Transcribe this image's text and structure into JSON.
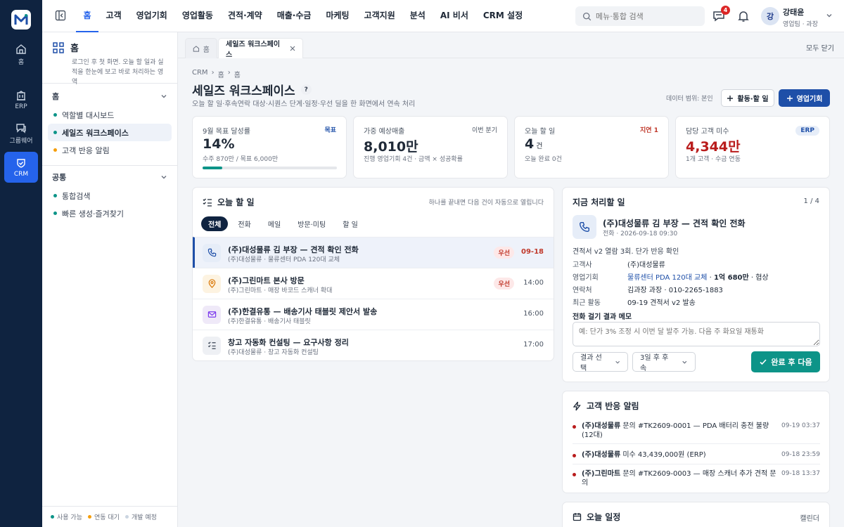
{
  "colors": {
    "primary": "#1e4fa8",
    "accent": "#2563eb",
    "teal": "#0d9488",
    "danger": "#b91c1c",
    "rail": "#0f2340"
  },
  "rail": {
    "items": [
      {
        "label": "홈",
        "icon": "home-icon"
      },
      {
        "label": "ERP",
        "icon": "building-icon"
      },
      {
        "label": "그룹웨어",
        "icon": "chat-icon"
      },
      {
        "label": "CRM",
        "icon": "handshake-icon"
      }
    ]
  },
  "topnav": {
    "items": [
      "홈",
      "고객",
      "영업기회",
      "영업활동",
      "견적·계약",
      "매출·수금",
      "마케팅",
      "고객지원",
      "분석",
      "AI 비서",
      "CRM 설정"
    ],
    "active": "홈",
    "search_placeholder": "메뉴·통합 검색",
    "notif_count": "4",
    "user_initial": "강",
    "user_name": "강태윤",
    "user_role": "영업팀 · 과장"
  },
  "sidebar": {
    "title": "홈",
    "desc": "로그인 후 첫 화면. 오늘 할 일과 실적을 한눈에 보고 바로 처리하는 영역",
    "groups": [
      {
        "title": "홈",
        "items": [
          {
            "label": "역할별 대시보드",
            "status": "available"
          },
          {
            "label": "세일즈 워크스페이스",
            "status": "available"
          },
          {
            "label": "고객 반응 알림",
            "status": "pending"
          }
        ]
      },
      {
        "title": "공통",
        "items": [
          {
            "label": "통합검색",
            "status": "available"
          },
          {
            "label": "빠른 생성·즐겨찾기",
            "status": "available"
          }
        ]
      }
    ],
    "legend": [
      "사용 가능",
      "연동 대기",
      "개발 예정"
    ]
  },
  "tabs": {
    "home": "홈",
    "current": "세일즈 워크스페이스",
    "close_all": "모두 닫기"
  },
  "page": {
    "breadcrumb": [
      "CRM",
      "홈",
      "홈"
    ],
    "title": "세일즈 워크스페이스",
    "help": "?",
    "subtitle": "오늘 할 일·후속연락 대상·시퀀스 단계·일정·우선 딜을 한 화면에서 연속 처리",
    "scope": "데이터 범위: 본인",
    "btn_activity": "활동·할 일",
    "btn_opportunity": "영업기회"
  },
  "kpis": [
    {
      "label": "9월 목표 달성률",
      "tag": "목표",
      "value": "14%",
      "unit": "",
      "sub": "수주 870만 / 목표 6,000만",
      "progress": 0.145
    },
    {
      "label": "가중 예상매출",
      "tag": "이번 분기",
      "value": "8,010만",
      "unit": "",
      "sub": "진행 영업기회 4건 · 금액 × 성공확률"
    },
    {
      "label": "오늘 할 일",
      "tag": "지연 1",
      "value": "4",
      "unit": "건",
      "sub": "오늘 완료 0건"
    },
    {
      "label": "담당 고객 미수",
      "tag": "ERP",
      "value": "4,344만",
      "unit": "",
      "sub": "1개 고객 · 수금 연동"
    }
  ],
  "todo": {
    "title": "오늘 할 일",
    "hint": "하나를 끝내면 다음 건이 자동으로 열립니다",
    "filters": [
      "전체",
      "전화",
      "메일",
      "방문·미팅",
      "할 일"
    ],
    "rows": [
      {
        "icon": "phone-icon",
        "title": "(주)대성물류 김 부장 — 견적 확인 전화",
        "sub": "(주)대성물류 · 물류센터 PDA 120대 교체",
        "priority": "우선",
        "time": "09-18"
      },
      {
        "icon": "map-pin-icon",
        "title": "(주)그린마트 본사 방문",
        "sub": "(주)그린마트 · 매장 바코드 스캐너 확대",
        "priority": "우선",
        "time": "14:00"
      },
      {
        "icon": "mail-icon",
        "title": "(주)한결유통 — 배송기사 태블릿 제안서 발송",
        "sub": "(주)한결유통 · 배송기사 태블릿",
        "priority": "",
        "time": "16:00"
      },
      {
        "icon": "checklist-icon",
        "title": "창고 자동화 컨설팅 — 요구사항 정리",
        "sub": "(주)대성물류 · 창고 자동화 컨설팅",
        "priority": "",
        "time": "17:00"
      }
    ]
  },
  "now": {
    "title": "지금 처리할 일",
    "counter": "1 / 4",
    "task_title": "(주)대성물류 김 부장 — 견적 확인 전화",
    "task_meta": "전화 · 2026-09-18 09:30",
    "desc": "견적서 v2 열람 3회. 단가 반응 확인",
    "fields": [
      {
        "k": "고객사",
        "v": "(주)대성물류"
      },
      {
        "k": "영업기회",
        "v": "물류센터 PDA 120대 교체",
        "amount": "1억 680만",
        "stage": "· 협상"
      },
      {
        "k": "연락처",
        "v": "김과장 과장 · 010-2265-1883"
      },
      {
        "k": "최근 활동",
        "v": "09-19 견적서 v2 발송"
      }
    ],
    "memo_label": "전화 걸기 결과 메모",
    "memo_placeholder": "예: 단가 3% 조정 시 이번 달 발주 가능. 다음 주 화요일 재통화",
    "result_select": "결과 선택",
    "followup_select": "3일 후 후속",
    "complete_btn": "완료 후 다음"
  },
  "alerts": {
    "title": "고객 반응 알림",
    "items": [
      {
        "company": "(주)대성물류",
        "text": "문의 #TK2609-0001 — PDA 배터리 충전 불량 (12대)",
        "time": "09-19 03:37"
      },
      {
        "company": "(주)대성물류",
        "text": "미수 43,439,000원 (ERP)",
        "time": "09-18 23:59"
      },
      {
        "company": "(주)그린마트",
        "text": "문의 #TK2609-0003 — 매장 스캐너 추가 견적 문의",
        "time": "09-18 13:37"
      }
    ]
  },
  "schedule": {
    "title": "오늘 일정",
    "link": "캘린더"
  }
}
